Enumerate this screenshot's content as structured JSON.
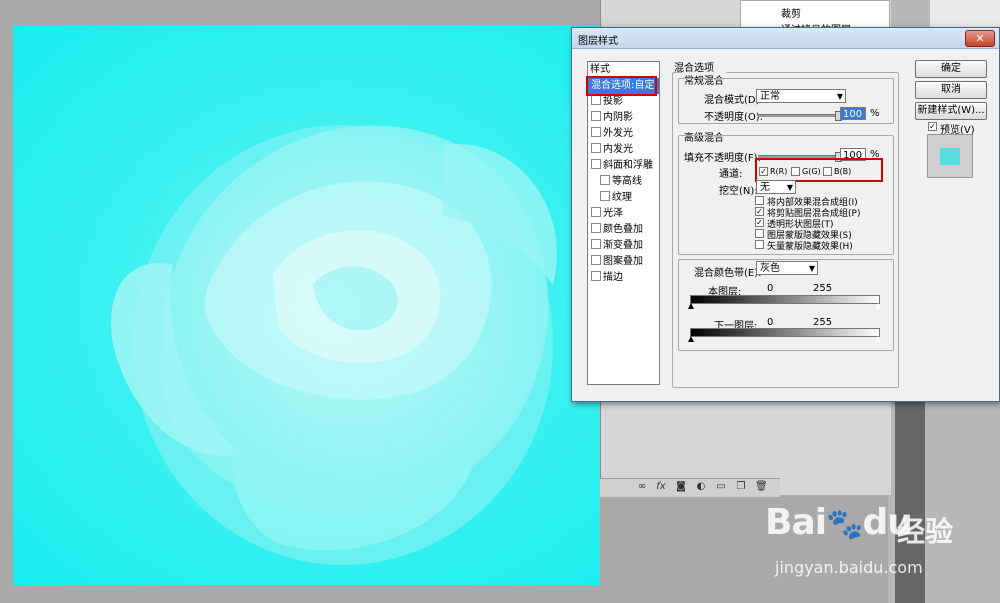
{
  "background_app": {
    "layers_panel": {
      "items": [
        "裁剪",
        "通过拷贝的图层"
      ]
    }
  },
  "dialog": {
    "title": "图层样式",
    "close_icon": "close-icon",
    "styles_list": {
      "header": "样式",
      "selected": "混合选项:自定",
      "items": [
        {
          "label": "投影",
          "sub": false,
          "checkbox": true
        },
        {
          "label": "内阴影",
          "sub": false,
          "checkbox": true
        },
        {
          "label": "外发光",
          "sub": false,
          "checkbox": true
        },
        {
          "label": "内发光",
          "sub": false,
          "checkbox": true
        },
        {
          "label": "斜面和浮雕",
          "sub": false,
          "checkbox": true
        },
        {
          "label": "等高线",
          "sub": true,
          "checkbox": true
        },
        {
          "label": "纹理",
          "sub": true,
          "checkbox": true
        },
        {
          "label": "光泽",
          "sub": false,
          "checkbox": true
        },
        {
          "label": "颜色叠加",
          "sub": false,
          "checkbox": true
        },
        {
          "label": "渐变叠加",
          "sub": false,
          "checkbox": true
        },
        {
          "label": "图案叠加",
          "sub": false,
          "checkbox": true
        },
        {
          "label": "描边",
          "sub": false,
          "checkbox": true
        }
      ]
    },
    "blending_options": {
      "title": "混合选项",
      "general": {
        "title": "常规混合",
        "blend_mode_label": "混合模式(D):",
        "blend_mode_value": "正常",
        "opacity_label": "不透明度(O):",
        "opacity_value": "100",
        "opacity_unit": "%",
        "opacity_fraction": 1.0
      },
      "advanced": {
        "title": "高级混合",
        "fill_opacity_label": "填充不透明度(F):",
        "fill_opacity_value": "100",
        "fill_opacity_unit": "%",
        "fill_opacity_fraction": 1.0,
        "channels_label": "通道:",
        "channels": [
          {
            "label": "R(R)",
            "checked": true
          },
          {
            "label": "G(G)",
            "checked": false
          },
          {
            "label": "B(B)",
            "checked": false
          }
        ],
        "knockout_label": "挖空(N):",
        "knockout_value": "无",
        "options": [
          {
            "label": "将内部效果混合成组(I)",
            "checked": false
          },
          {
            "label": "将剪贴图层混合成组(P)",
            "checked": true
          },
          {
            "label": "透明形状图层(T)",
            "checked": true
          },
          {
            "label": "图层蒙版隐藏效果(S)",
            "checked": false
          },
          {
            "label": "矢量蒙版隐藏效果(H)",
            "checked": false
          }
        ]
      },
      "blend_if": {
        "label": "混合颜色带(E):",
        "value": "灰色",
        "this_layer_label": "本图层:",
        "this_layer_low": "0",
        "this_layer_high": "255",
        "underlying_label": "下一图层:",
        "underlying_low": "0",
        "underlying_high": "255"
      }
    },
    "buttons": {
      "ok": "确定",
      "cancel": "取消",
      "new_style": "新建样式(W)...",
      "preview_label": "预览(V)",
      "preview_checked": true
    },
    "colors": {
      "selection": "#3a7bd5",
      "highlight_box": "#d40000",
      "preview_swatch": "#55dde0"
    }
  },
  "watermark": {
    "logo": "Bai",
    "logo2": "du",
    "cn": "经验",
    "url": "jingyan.baidu.com"
  }
}
